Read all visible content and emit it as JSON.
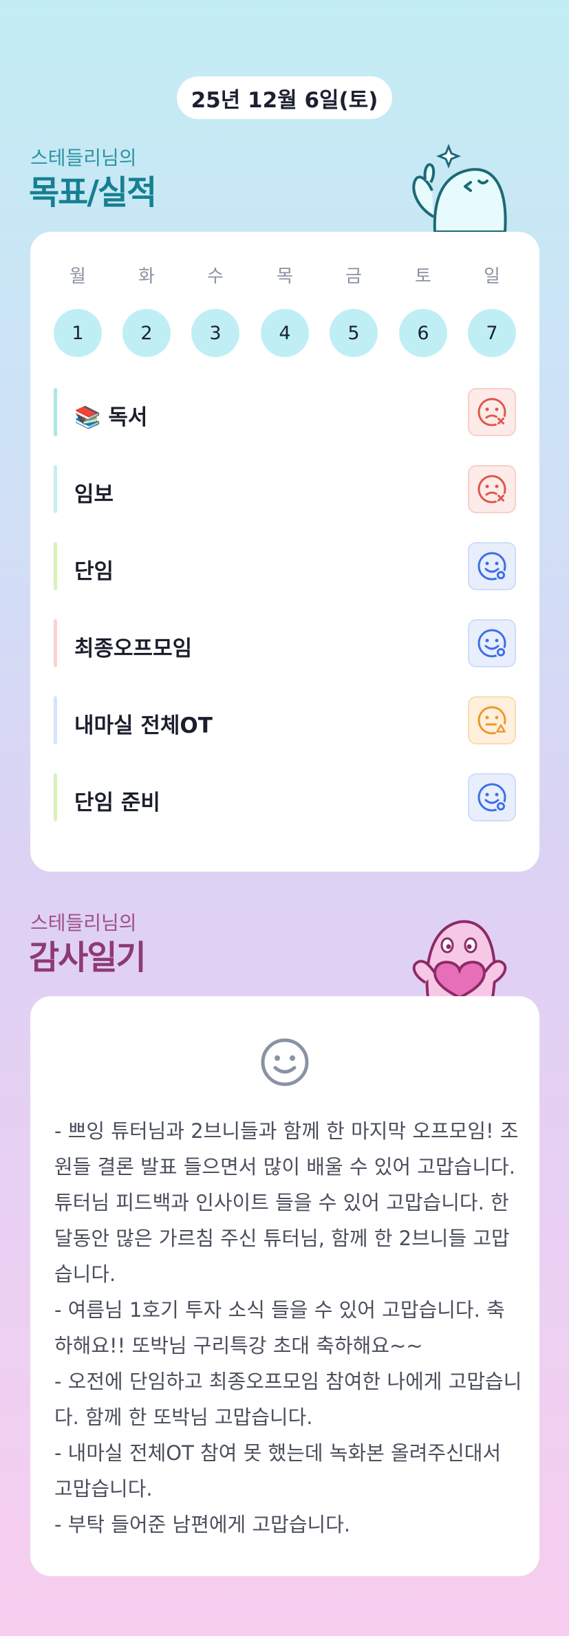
{
  "date": "25년 12월 6일(토)",
  "goals_section": {
    "subtitle": "스테들리님의",
    "title": "목표/실적"
  },
  "week": {
    "days": [
      "월",
      "화",
      "수",
      "목",
      "금",
      "토",
      "일"
    ],
    "dates": [
      "1",
      "2",
      "3",
      "4",
      "5",
      "6",
      "7"
    ]
  },
  "goals": [
    {
      "label": "📚 독서",
      "status": "fail",
      "icon": "sad-x-face-icon",
      "bar_color": "#a9e8e0"
    },
    {
      "label": "임보",
      "status": "fail",
      "icon": "sad-x-face-icon",
      "bar_color": "#c4eef4"
    },
    {
      "label": "단임",
      "status": "done",
      "icon": "smile-face-icon",
      "bar_color": "#d8f2b8"
    },
    {
      "label": "최종오프모임",
      "status": "done",
      "icon": "smile-face-icon",
      "bar_color": "#fad2cf"
    },
    {
      "label": "내마실 전체OT",
      "status": "partial",
      "icon": "neutral-triangle-face-icon",
      "bar_color": "#d6e3fa"
    },
    {
      "label": "단임 준비",
      "status": "done",
      "icon": "smile-face-icon",
      "bar_color": "#d8f2b8"
    }
  ],
  "thanks_section": {
    "subtitle": "스테들리님의",
    "title": "감사일기"
  },
  "diary": {
    "mood_icon": "smile-face-icon",
    "text": "- 쁘잉 튜터님과 2브니들과 함께 한 마지막 오프모임! 조원들 결론 발표 들으면서 많이 배울 수 있어 고맙습니다. 튜터님 피드백과 인사이트 들을 수 있어 고맙습니다. 한달동안 많은 가르침 주신 튜터님, 함께 한 2브니들 고맙습니다.\n- 여름님 1호기 투자 소식 들을 수 있어 고맙습니다. 축하해요!! 또박님 구리특강 초대 축하해요~~\n- 오전에 단임하고 최종오프모임 참여한 나에게 고맙습니다. 함께 한 또박님 고맙습니다.\n- 내마실 전체OT 참여 못 했는데 녹화본 올려주신대서 고맙습니다.\n- 부탁 들어준 남편에게 고맙습니다."
  },
  "colors": {
    "fail": "#e0564a",
    "done": "#3d6ee8",
    "partial": "#f0962a",
    "goals_title": "#167f92",
    "thanks_title": "#8e3a72"
  }
}
